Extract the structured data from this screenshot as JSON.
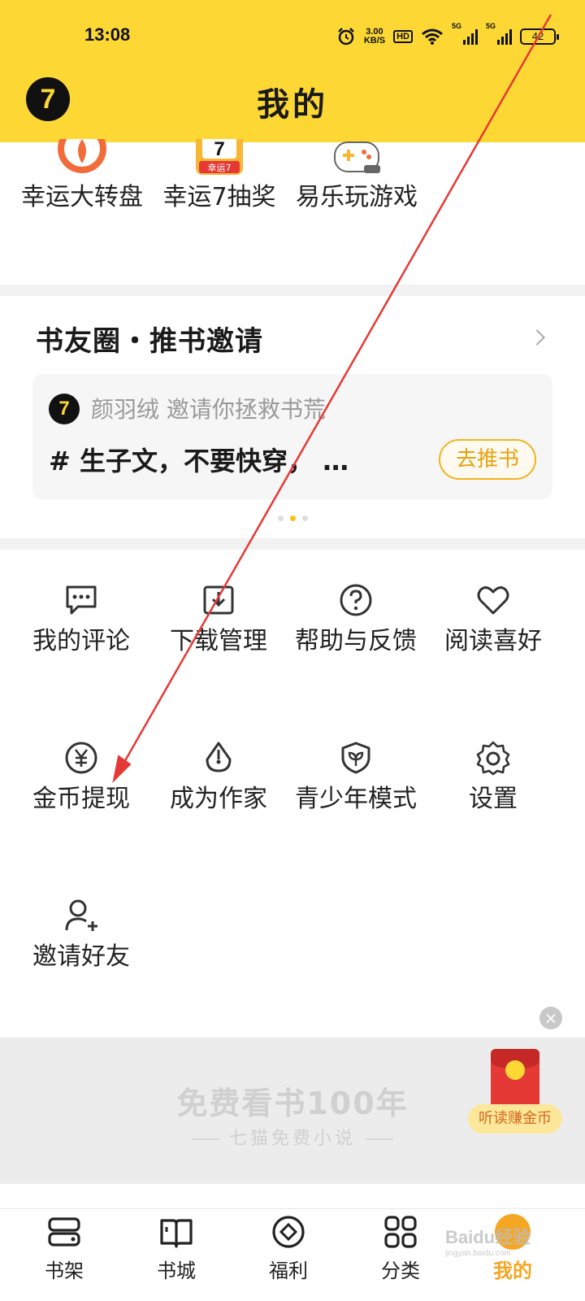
{
  "status_bar": {
    "time": "13:08",
    "speed_top": "3.00",
    "speed_bottom": "KB/S",
    "hd": "HD",
    "sim1": "5G",
    "sim2": "5G",
    "battery": "42"
  },
  "header": {
    "title": "我的",
    "avatar_text": "7"
  },
  "activities": [
    {
      "label": "幸运大转盘",
      "icon": "spin-wheel-icon"
    },
    {
      "label": "幸运7抽奖",
      "icon": "lucky-seven-icon"
    },
    {
      "label": "易乐玩游戏",
      "icon": "gamepad-icon"
    }
  ],
  "lucky_badge": "幸运7",
  "book_circle": {
    "title": "书友圈・推书邀请",
    "inviter": "颜羽绒 邀请你拯救书荒",
    "post": "# 生子文，不要快穿， …",
    "button": "去推书"
  },
  "functions": [
    {
      "label": "我的评论",
      "icon": "comment-icon"
    },
    {
      "label": "下载管理",
      "icon": "download-icon"
    },
    {
      "label": "帮助与反馈",
      "icon": "help-icon"
    },
    {
      "label": "阅读喜好",
      "icon": "heart-icon"
    },
    {
      "label": "金币提现",
      "icon": "coin-yen-icon"
    },
    {
      "label": "成为作家",
      "icon": "pen-nib-icon"
    },
    {
      "label": "青少年模式",
      "icon": "youth-shield-icon"
    },
    {
      "label": "设置",
      "icon": "gear-icon"
    },
    {
      "label": "邀请好友",
      "icon": "add-user-icon"
    }
  ],
  "banner": {
    "headline": "免费看书100年",
    "sub": "七猫免费小说"
  },
  "floating": {
    "label": "听读赚金币",
    "close": "×"
  },
  "bottom_nav": [
    {
      "label": "书架",
      "icon": "bookshelf-icon"
    },
    {
      "label": "书城",
      "icon": "book-icon"
    },
    {
      "label": "福利",
      "icon": "gift-coin-icon"
    },
    {
      "label": "分类",
      "icon": "grid-icon"
    },
    {
      "label": "我的",
      "icon": "profile-cat-icon"
    }
  ],
  "watermark": {
    "brand": "Baidu经验",
    "url": "jingyan.baidu.com"
  },
  "colors": {
    "header_bg": "#fdd835",
    "accent": "#f5a623",
    "annotation_arrow": "#e53935"
  }
}
